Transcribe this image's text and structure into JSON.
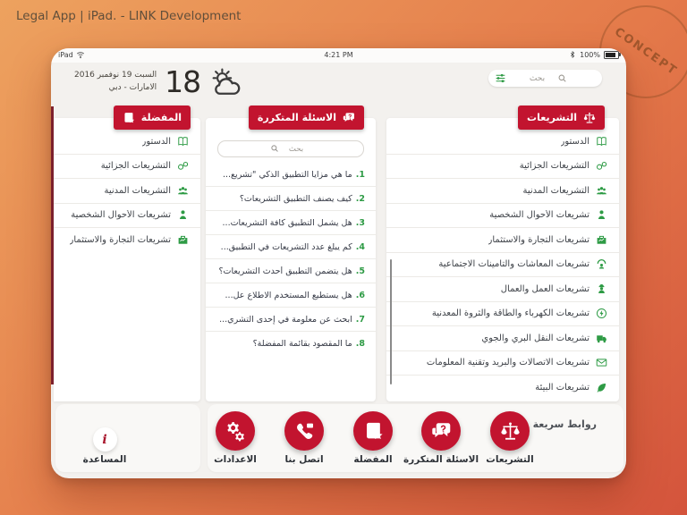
{
  "header": {
    "title": "Legal App | iPad. - LINK Development",
    "stamp": "CONCEPT"
  },
  "colors": {
    "accent_red": "#c2142f",
    "green": "#2e9b45",
    "maroon_edge": "#7e212e",
    "bg_gradient_start": "#eda25f",
    "bg_gradient_end": "#d4543c",
    "screen_bg": "#f3f1ee"
  },
  "status_bar": {
    "device_label": "iPad",
    "time": "4:21 PM",
    "battery": "100%",
    "icons": [
      "wifi-icon",
      "bluetooth-icon",
      "battery-icon"
    ]
  },
  "weather": {
    "date": "السبت 19 نوفمبر 2016",
    "location": "الامارات - دبي",
    "temperature": "18",
    "icon": "cloud-sun-icon"
  },
  "top_search": {
    "placeholder": "بحث",
    "icons": [
      "search-icon",
      "filter-sliders-icon"
    ]
  },
  "legislations_panel": {
    "title": "التشريعات",
    "icon": "scales-icon",
    "items": [
      {
        "label": "الدستور",
        "icon": "book-icon"
      },
      {
        "label": "التشريعات الجزائية",
        "icon": "handcuffs-icon"
      },
      {
        "label": "التشريعات المدنية",
        "icon": "people-icon"
      },
      {
        "label": "تشريعات الأحوال الشخصية",
        "icon": "person-icon"
      },
      {
        "label": "تشريعات التجارة والاستثمار",
        "icon": "briefcase-icon"
      },
      {
        "label": "تشريعات المعاشات والتأمينات الاجتماعية",
        "icon": "pension-icon"
      },
      {
        "label": "تشريعات العمل والعمال",
        "icon": "worker-icon"
      },
      {
        "label": "تشريعات الكهرباء والطاقة والثروة المعدنية",
        "icon": "energy-icon"
      },
      {
        "label": "تشريعات النقل البري والجوي",
        "icon": "transport-icon"
      },
      {
        "label": "تشريعات الاتصالات والبريد وتقنية المعلومات",
        "icon": "communications-icon"
      },
      {
        "label": "تشريعات البيئة",
        "icon": "environment-icon"
      }
    ]
  },
  "faq_panel": {
    "title": "الاسئلة المتكررة",
    "icon": "chat-question-icon",
    "search_placeholder": "بحث",
    "items": [
      {
        "num": "1.",
        "text": "ما هي مزايا التطبيق الذكي \"تشريع..."
      },
      {
        "num": "2.",
        "text": "كيف يصنف التطبيق التشريعات؟"
      },
      {
        "num": "3.",
        "text": "هل يشمل التطبيق كافة التشريعات..."
      },
      {
        "num": "4.",
        "text": "كم يبلغ عدد التشريعات في التطبيق..."
      },
      {
        "num": "5.",
        "text": "هل يتضمن التطبيق أحدث التشريعات؟"
      },
      {
        "num": "6.",
        "text": "هل يستطيع المستخدم الاطلاع عل..."
      },
      {
        "num": "7.",
        "text": "ابحث عن معلومة في إحدى التشري..."
      },
      {
        "num": "8.",
        "text": "ما المقصود بقائمة المفضلة؟"
      }
    ]
  },
  "favorites_panel": {
    "title": "المفضلة",
    "icon": "book-star-icon",
    "items": [
      {
        "label": "الدستور",
        "icon": "book-icon"
      },
      {
        "label": "التشريعات الجزائية",
        "icon": "handcuffs-icon"
      },
      {
        "label": "التشريعات المدنية",
        "icon": "people-icon"
      },
      {
        "label": "تشريعات الأحوال الشخصية",
        "icon": "person-icon"
      },
      {
        "label": "تشريعات التجارة والاستثمار",
        "icon": "briefcase-icon"
      }
    ]
  },
  "quick_links": {
    "label": "روابط سريعة",
    "buttons": [
      {
        "label": "التشريعات",
        "icon": "scales-icon"
      },
      {
        "label": "الاسئلة المتكررة",
        "icon": "chat-question-icon"
      },
      {
        "label": "المفضلة",
        "icon": "book-star-icon"
      },
      {
        "label": "اتصل بنا",
        "icon": "phone-icon"
      },
      {
        "label": "الاعدادات",
        "icon": "gears-icon"
      }
    ],
    "help": {
      "label": "المساعدة",
      "icon": "info-icon"
    }
  }
}
